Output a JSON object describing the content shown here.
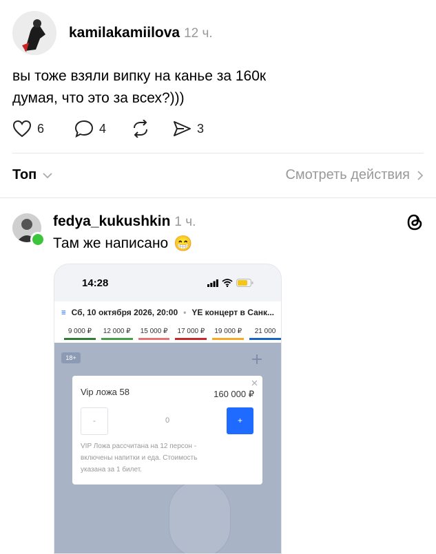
{
  "post": {
    "username": "kamilakamiilova",
    "time": "12 ч.",
    "text_line1": "вы тоже взяли випку на канье за 160к",
    "text_line2": "думая, что это за всех?)))",
    "likes": "6",
    "comments": "4",
    "shares": "3"
  },
  "sort_bar": {
    "label": "Топ",
    "view_activity": "Смотреть действия"
  },
  "reply": {
    "username": "fedya_kukushkin",
    "time": "1 ч.",
    "text": "Там же написано",
    "emoji": "😁"
  },
  "screenshot": {
    "clock": "14:28",
    "event_title": "Сб, 10 октября 2026, 20:00",
    "event_name": "YE концерт в Санк...",
    "prices": [
      {
        "label": "9 000 ₽",
        "color": "#2e7d32"
      },
      {
        "label": "12 000 ₽",
        "color": "#43a047"
      },
      {
        "label": "15 000 ₽",
        "color": "#e57373"
      },
      {
        "label": "17 000 ₽",
        "color": "#c62828"
      },
      {
        "label": "19 000 ₽",
        "color": "#f9a825"
      },
      {
        "label": "21 000",
        "color": "#1565c0"
      }
    ],
    "age_badge": "18+",
    "modal": {
      "title": "Vip ложа 58",
      "price": "160 000 ₽",
      "minus": "-",
      "qty": "0",
      "plus": "+",
      "description_1": "VIP Ложа рассчитана на 12 персон -",
      "description_2": "включены напитки и еда. Стоимость",
      "description_3": "указана за 1 билет."
    }
  },
  "colors": {
    "accent_blue": "#1f6bff",
    "online_green": "#3cc43c"
  }
}
